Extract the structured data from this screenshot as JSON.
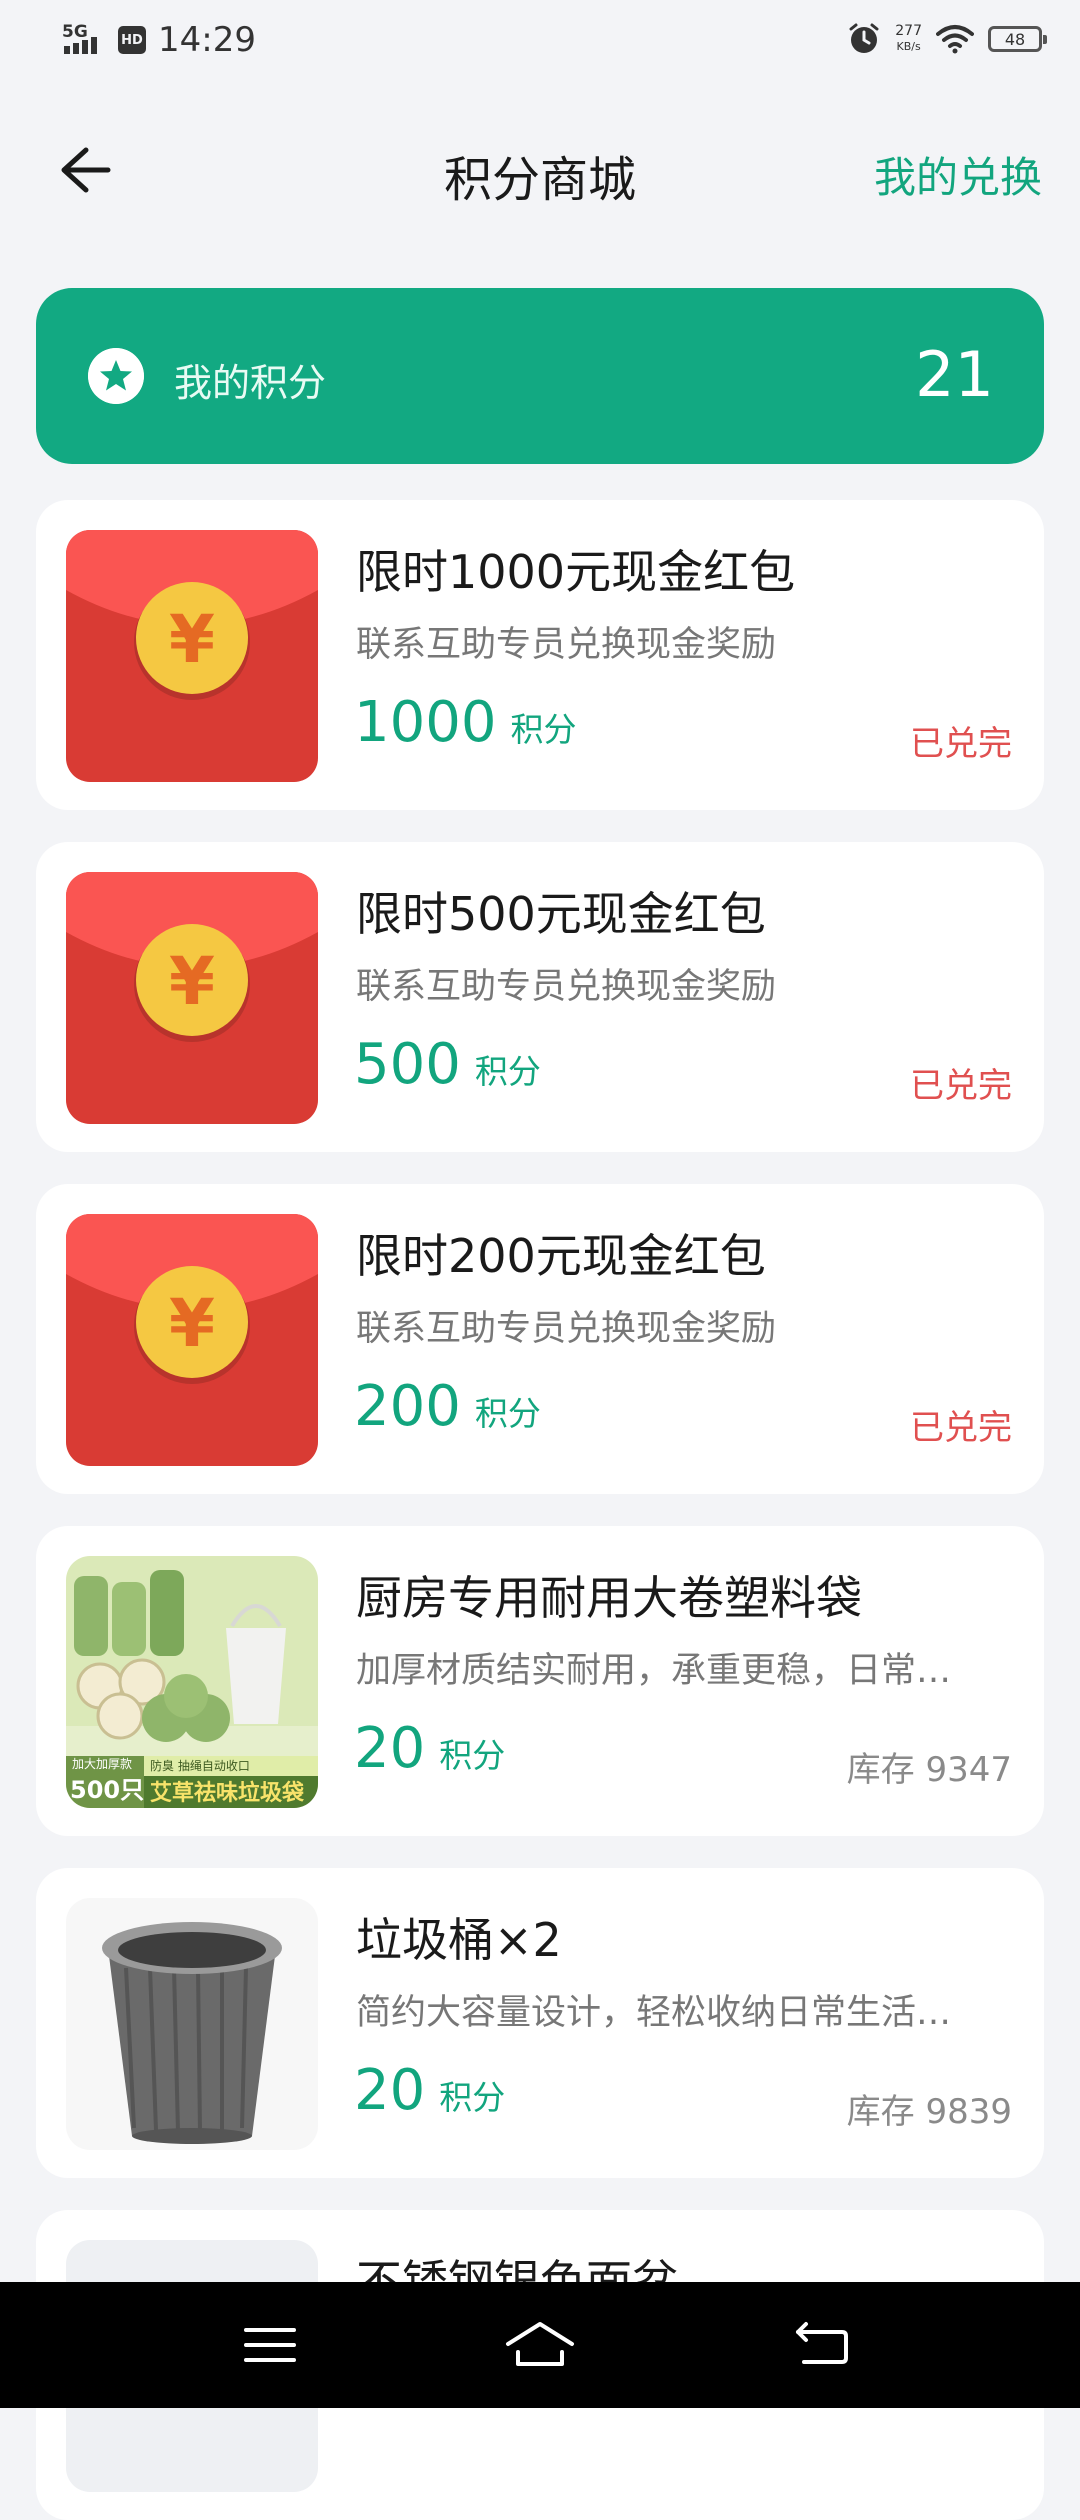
{
  "status_bar": {
    "network": "5G",
    "hd": "HD",
    "time": "14:29",
    "net_speed_value": "277",
    "net_speed_unit": "KB/s",
    "battery": "48"
  },
  "header": {
    "title": "积分商城",
    "my_exchange": "我的兑换"
  },
  "points": {
    "label": "我的积分",
    "value": "21"
  },
  "products": [
    {
      "title": "限时1000元现金红包",
      "desc": "联系互助专员兑换现金奖励",
      "price": "1000",
      "unit": "积分",
      "status": "已兑完"
    },
    {
      "title": "限时500元现金红包",
      "desc": "联系互助专员兑换现金奖励",
      "price": "500",
      "unit": "积分",
      "status": "已兑完"
    },
    {
      "title": "限时200元现金红包",
      "desc": "联系互助专员兑换现金奖励",
      "price": "200",
      "unit": "积分",
      "status": "已兑完"
    },
    {
      "title": "厨房专用耐用大卷塑料袋",
      "desc": "加厚材质结实耐用，承重更稳，日常…",
      "price": "20",
      "unit": "积分",
      "stock": "库存 9347",
      "img_text_1": "加大加厚款",
      "img_text_2": "500只",
      "img_text_3": "防臭 抽绳自动收口",
      "img_text_4": "艾草祛味垃圾袋"
    },
    {
      "title": "垃圾桶×2",
      "desc": "简约大容量设计，轻松收纳日常生活…",
      "price": "20",
      "unit": "积分",
      "stock": "库存 9839"
    },
    {
      "title": "不锈钢银色面盆"
    }
  ],
  "colors": {
    "accent": "#12a57e",
    "banner": "#12a982",
    "sold_out": "#e05050",
    "red_packet": "#e0403a",
    "coin": "#f5c842"
  },
  "icons": [
    "back-arrow-icon",
    "star-icon",
    "alarm-icon",
    "wifi-icon",
    "battery-icon",
    "menu-icon",
    "home-icon",
    "return-icon",
    "yuan-coin-icon"
  ]
}
